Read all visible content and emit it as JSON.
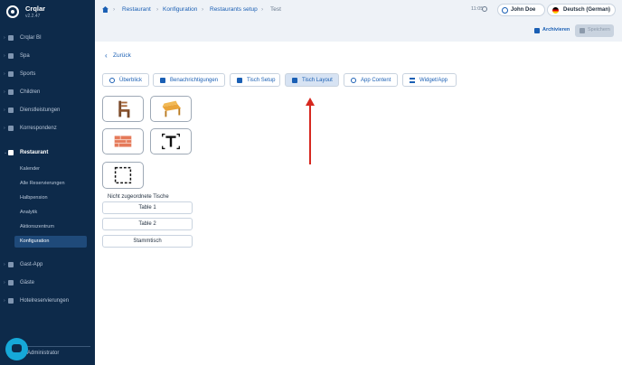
{
  "brand": {
    "name": "Crqlar",
    "version": "v2.2.47"
  },
  "sidebar": {
    "items": [
      {
        "label": "Crqlar BI"
      },
      {
        "label": "Spa"
      },
      {
        "label": "Sports"
      },
      {
        "label": "Children"
      },
      {
        "label": "Dienstleistungen"
      },
      {
        "label": "Korrespondenz"
      },
      {
        "label": "Restaurant"
      },
      {
        "label": "Gast-App"
      },
      {
        "label": "Gäste"
      },
      {
        "label": "Hotelreservierungen"
      }
    ],
    "restaurant_sub": [
      {
        "label": "Kalender"
      },
      {
        "label": "Alle Reservierungen"
      },
      {
        "label": "Halbpension"
      },
      {
        "label": "Analytik"
      },
      {
        "label": "Aktionszentrum"
      },
      {
        "label": "Konfiguration"
      }
    ],
    "admin_label": "Administrator"
  },
  "breadcrumb": {
    "items": [
      "Restaurant",
      "Konfiguration",
      "Restaurants setup",
      "Test"
    ],
    "separator": "›"
  },
  "header": {
    "time": "11:05",
    "user_name": "John Doe",
    "language": "Deutsch (German)"
  },
  "actions": {
    "archive_label": "Archivieren",
    "save_label": "Speichern"
  },
  "back_label": "Zurück",
  "tabs": [
    {
      "label": "Überblick"
    },
    {
      "label": "Benachrichtigungen"
    },
    {
      "label": "Tisch Setup"
    },
    {
      "label": "Tisch Layout"
    },
    {
      "label": "App Content"
    },
    {
      "label": "Widget/App"
    }
  ],
  "tiles": [
    {
      "name": "chair-icon"
    },
    {
      "name": "bench-icon"
    },
    {
      "name": "brick-wall-icon"
    },
    {
      "name": "text-icon"
    },
    {
      "name": "dashed-area-icon"
    }
  ],
  "unassigned_label": "Nicht zugeordnete Tische",
  "tables": [
    "Table 1",
    "Table 2",
    "Stammtisch"
  ],
  "colors": {
    "sidebar_bg": "#0d2a4a",
    "accent": "#1a5fb4",
    "annotation_arrow": "#d6281f"
  }
}
